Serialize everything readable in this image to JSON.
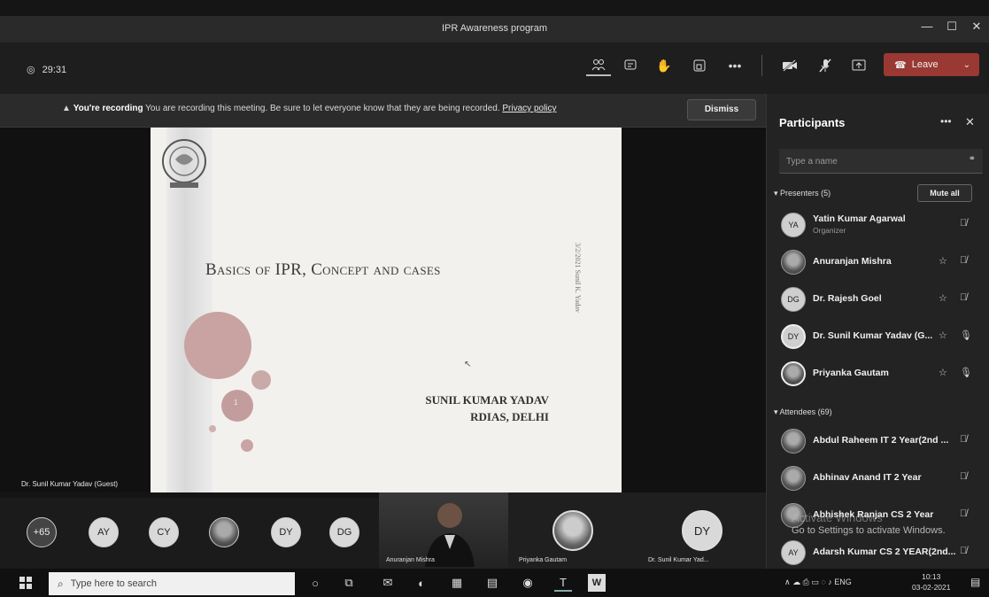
{
  "window": {
    "title": "IPR Awareness program"
  },
  "toolbar": {
    "timer": "29:31",
    "icons": [
      "participants-icon",
      "chat-icon",
      "raise-hand-icon",
      "rooms-icon",
      "more-icon",
      "camera-off-icon",
      "mic-off-icon",
      "share-icon"
    ],
    "leave_label": "Leave"
  },
  "banner": {
    "label": "You're recording",
    "message": "You are recording this meeting. Be sure to let everyone know that they are being recorded.",
    "link": "Privacy policy",
    "dismiss_label": "Dismiss"
  },
  "slide": {
    "title": "Basics of IPR, Concept and cases",
    "author_name": "SUNIL KUMAR YADAV",
    "author_org": "RDIAS, DELHI",
    "vertical_text": "3/2/2021   Sunil K. Yadav",
    "page_number": "1"
  },
  "stage": {
    "speaker_label": "Dr. Sunil Kumar Yadav (Guest)"
  },
  "tiles": {
    "overflow": "+65",
    "avatars": [
      "AY",
      "CY",
      "",
      "DY",
      "DG"
    ],
    "video_tiles": [
      {
        "name": "Anuranjan Mishra"
      },
      {
        "name": "Priyanka Gautam"
      },
      {
        "name": "Dr. Sunil Kumar Yad...",
        "initials": "DY"
      }
    ]
  },
  "panel": {
    "title": "Participants",
    "search_placeholder": "Type a name",
    "presenters_header": "Presenters (5)",
    "mute_all_label": "Mute all",
    "presenters": [
      {
        "initials": "YA",
        "name": "Yatin Kumar Agarwal",
        "role": "Organizer"
      },
      {
        "initials": "",
        "name": "Anuranjan Mishra"
      },
      {
        "initials": "DG",
        "name": "Dr. Rajesh Goel"
      },
      {
        "initials": "DY",
        "name": "Dr. Sunil Kumar Yadav (G..."
      },
      {
        "initials": "",
        "name": "Priyanka Gautam"
      }
    ],
    "attendees_header": "Attendees (69)",
    "attendees": [
      {
        "initials": "",
        "name": "Abdul Raheem IT 2 Year(2nd ..."
      },
      {
        "initials": "",
        "name": "Abhinav Anand IT 2 Year"
      },
      {
        "initials": "",
        "name": "Abhishek Ranjan CS 2 Year"
      },
      {
        "initials": "AY",
        "name": "Adarsh Kumar CS 2 YEAR(2nd..."
      }
    ]
  },
  "activation": {
    "line1": "Activate Windows",
    "line2": "Go to Settings to activate Windows."
  },
  "taskbar": {
    "search_placeholder": "Type here to search",
    "lang": "ENG",
    "time": "10:13",
    "date": "03-02-2021"
  },
  "colors": {
    "leave": "#9a3833",
    "background": "#151515",
    "panel": "#232323"
  }
}
